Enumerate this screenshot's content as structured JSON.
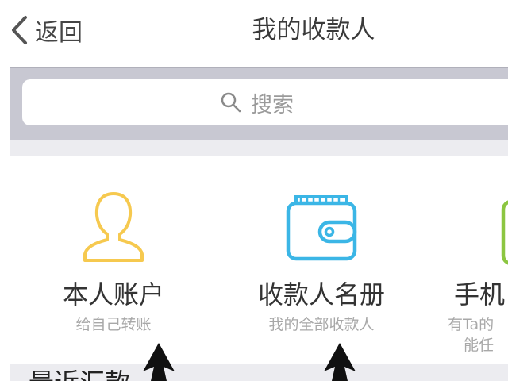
{
  "nav": {
    "back_label": "返回",
    "title": "我的收款人"
  },
  "search": {
    "placeholder": "搜索"
  },
  "tiles": [
    {
      "title": "本人账户",
      "subtitle": "给自己转账",
      "icon": "person-icon",
      "color": "#f6c94f"
    },
    {
      "title": "收款人名册",
      "subtitle": "我的全部收款人",
      "icon": "wallet-icon",
      "color": "#3bb6e6"
    },
    {
      "title": "手机",
      "subtitle_line1": "有Ta的",
      "subtitle_line2": "能任",
      "icon": "phone-icon",
      "color": "#8cc641"
    }
  ],
  "recent": {
    "title": "最近汇款"
  },
  "colors": {
    "search_band": "#c8c8d2",
    "accent_yellow": "#f6c94f",
    "accent_blue": "#3bb6e6",
    "accent_green": "#8cc641"
  }
}
